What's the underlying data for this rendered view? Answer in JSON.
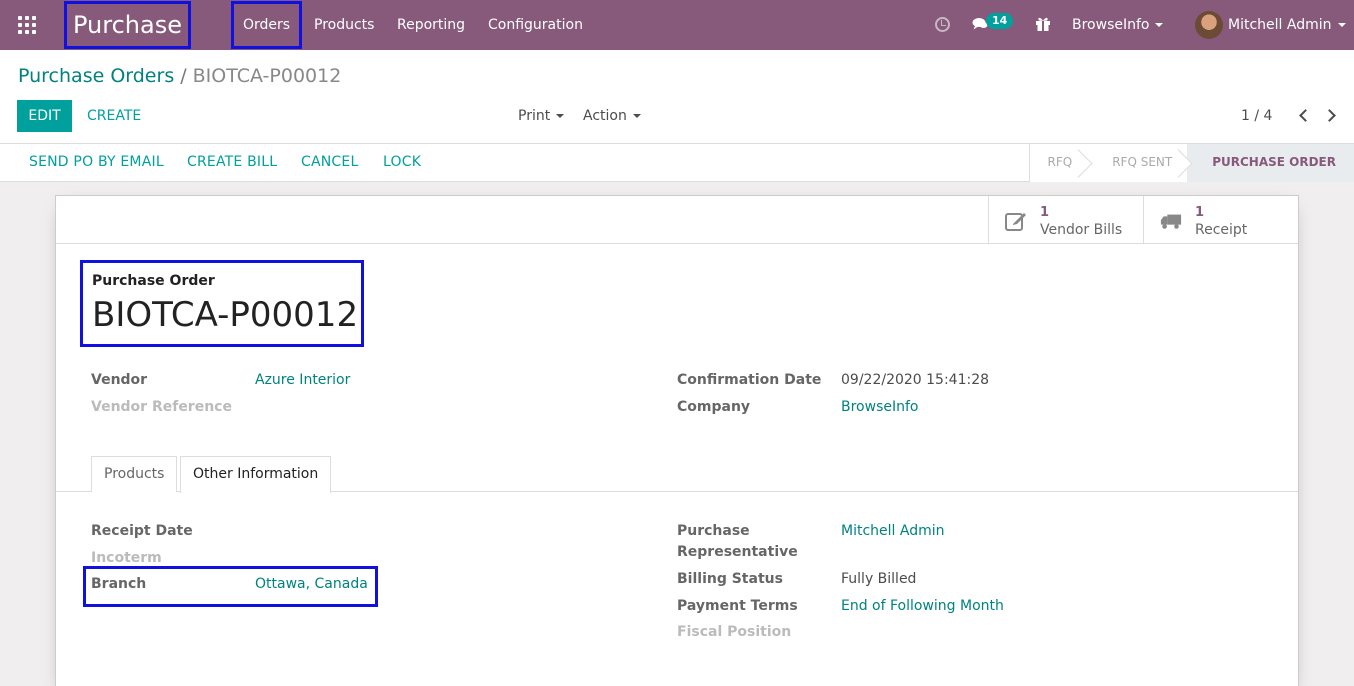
{
  "navbar": {
    "app_name": "Purchase",
    "menu": [
      "Orders",
      "Products",
      "Reporting",
      "Configuration"
    ],
    "message_count": "14",
    "company": "BrowseInfo",
    "user": "Mitchell Admin",
    "accent": "#875a7b"
  },
  "control_panel": {
    "breadcrumb_parent": "Purchase Orders",
    "breadcrumb_separator": "/",
    "breadcrumb_current": "BIOTCA-P00012",
    "edit_label": "EDIT",
    "create_label": "CREATE",
    "print_label": "Print",
    "action_label": "Action",
    "pager": "1 / 4"
  },
  "statusbar": {
    "buttons": [
      "SEND PO BY EMAIL",
      "CREATE BILL",
      "CANCEL",
      "LOCK"
    ],
    "stages": [
      "RFQ",
      "RFQ SENT",
      "PURCHASE ORDER"
    ],
    "current_stage": "PURCHASE ORDER"
  },
  "smart_buttons": [
    {
      "value": "1",
      "label": "Vendor Bills",
      "icon": "pencil-square-icon"
    },
    {
      "value": "1",
      "label": "Receipt",
      "icon": "truck-icon"
    }
  ],
  "record": {
    "type_label": "Purchase Order",
    "name": "BIOTCA-P00012"
  },
  "fields_left": [
    {
      "label": "Vendor",
      "value": "Azure Interior"
    },
    {
      "label": "Vendor Reference",
      "value": ""
    }
  ],
  "fields_right": [
    {
      "label": "Confirmation Date",
      "value": "09/22/2020 15:41:28"
    },
    {
      "label": "Company",
      "value": "BrowseInfo"
    }
  ],
  "tabs": [
    "Products",
    "Other Information"
  ],
  "active_tab": "Other Information",
  "other_info_left": [
    {
      "label": "Receipt Date",
      "value": ""
    },
    {
      "label": "Incoterm",
      "value": ""
    },
    {
      "label": "Branch",
      "value": "Ottawa, Canada"
    }
  ],
  "other_info_right": [
    {
      "label": "Purchase",
      "label2": "Representative",
      "value": "Mitchell Admin"
    },
    {
      "label": "Billing Status",
      "value": "Fully Billed"
    },
    {
      "label": "Payment Terms",
      "value": "End of Following Month"
    },
    {
      "label": "Fiscal Position",
      "value": ""
    }
  ]
}
